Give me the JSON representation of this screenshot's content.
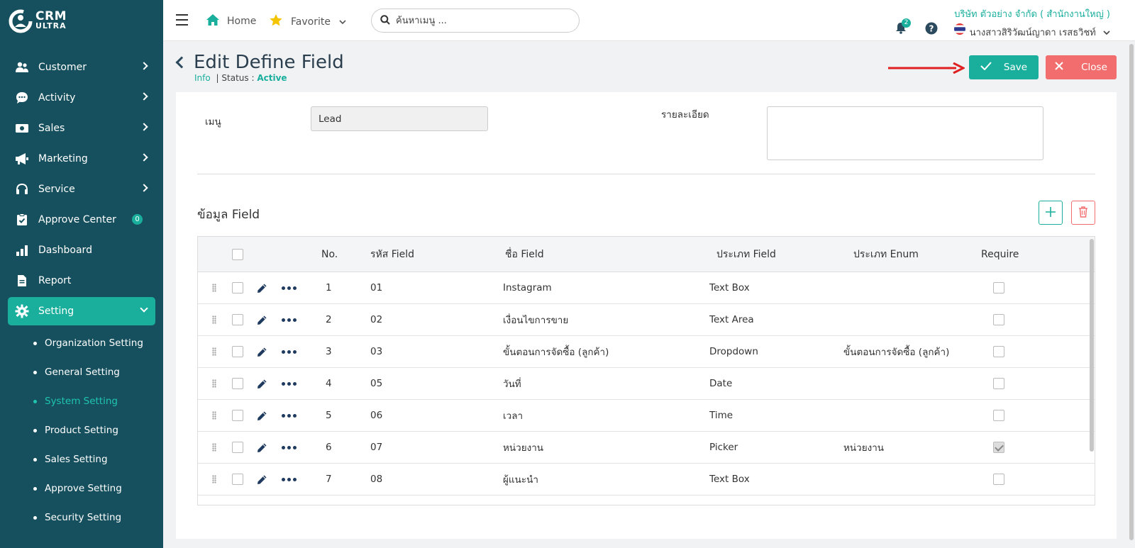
{
  "brand": {
    "line1": "CRM",
    "line2": "ULTRA"
  },
  "sidebar": {
    "items": [
      {
        "label": "Customer",
        "icon": "users-icon"
      },
      {
        "label": "Activity",
        "icon": "chat-icon"
      },
      {
        "label": "Sales",
        "icon": "money-icon"
      },
      {
        "label": "Marketing",
        "icon": "megaphone-icon"
      },
      {
        "label": "Service",
        "icon": "headset-icon"
      },
      {
        "label": "Approve Center",
        "icon": "clipboard-check-icon",
        "badge": "0"
      },
      {
        "label": "Dashboard",
        "icon": "bar-chart-icon"
      },
      {
        "label": "Report",
        "icon": "document-icon"
      },
      {
        "label": "Setting",
        "icon": "gear-icon"
      }
    ],
    "sub_items": [
      "Organization Setting",
      "General Setting",
      "System Setting",
      "Product Setting",
      "Sales Setting",
      "Approve Setting",
      "Security Setting"
    ]
  },
  "topbar": {
    "home": "Home",
    "favorite": "Favorite",
    "search_placeholder": "ค้นหาเมนู ...",
    "notification_count": "2",
    "company": "บริษัท ตัวอย่าง จำกัด ( สำนักงานใหญ่ )",
    "user": "นางสาวสิริวัฒน์ญาดา เรสธวิชท์"
  },
  "page": {
    "title": "Edit Define Field",
    "info": "Info",
    "status_label": "| Status :",
    "status_value": "Active",
    "save": "Save",
    "close": "Close"
  },
  "form": {
    "menu_label": "เมนู",
    "menu_value": "Lead",
    "detail_label": "รายละเอียด",
    "detail_value": ""
  },
  "section_title": "ข้อมูล Field",
  "table": {
    "headers": {
      "no": "No.",
      "code": "รหัส Field",
      "name": "ชื่อ Field",
      "type": "ประเภท Field",
      "enum": "ประเภท Enum",
      "require": "Require"
    },
    "rows": [
      {
        "no": "1",
        "code": "01",
        "name": "Instagram",
        "type": "Text Box",
        "enum": "",
        "require": false
      },
      {
        "no": "2",
        "code": "02",
        "name": "เงื่อนไขการขาย",
        "type": "Text Area",
        "enum": "",
        "require": false
      },
      {
        "no": "3",
        "code": "03",
        "name": "ขั้นตอนการจัดซื้อ (ลูกค้า)",
        "type": "Dropdown",
        "enum": "ขั้นตอนการจัดซื้อ (ลูกค้า)",
        "require": false
      },
      {
        "no": "4",
        "code": "05",
        "name": "วันที่",
        "type": "Date",
        "enum": "",
        "require": false
      },
      {
        "no": "5",
        "code": "06",
        "name": "เวลา",
        "type": "Time",
        "enum": "",
        "require": false
      },
      {
        "no": "6",
        "code": "07",
        "name": "หน่วยงาน",
        "type": "Picker",
        "enum": "หน่วยงาน",
        "require": true
      },
      {
        "no": "7",
        "code": "08",
        "name": "ผู้แนะนำ",
        "type": "Text Box",
        "enum": "",
        "require": false
      }
    ]
  },
  "colors": {
    "sidebar": "#16505e",
    "accent": "#1aaf9d",
    "danger": "#f26d6d"
  }
}
